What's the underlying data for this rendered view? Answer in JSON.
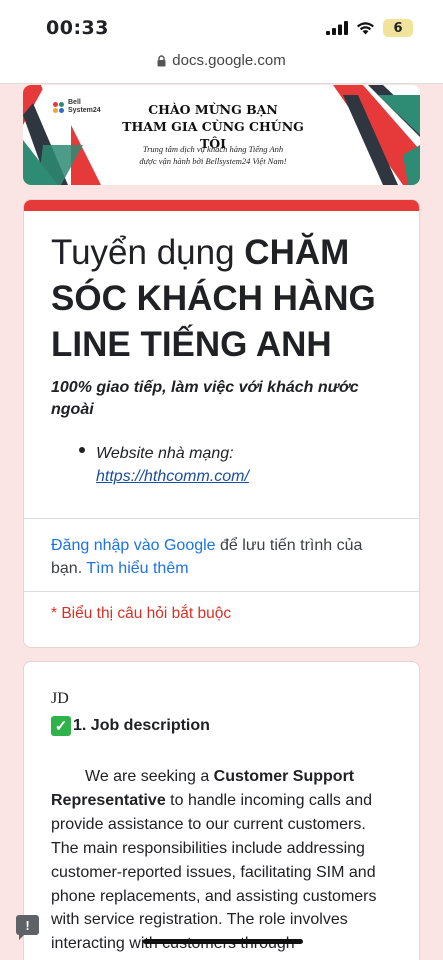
{
  "status_bar": {
    "time": "00:33",
    "battery": "6"
  },
  "browser": {
    "url": "docs.google.com"
  },
  "banner": {
    "logo_line1": "Bell",
    "logo_line2": "System24",
    "title_line1": "CHÀO MỪNG BẠN",
    "title_line2": "THAM GIA CÙNG CHÚNG TÔI",
    "sub_line1": "Trung tâm dịch vụ khách hàng Tiếng Anh",
    "sub_line2": "được vận hành bởi Bellsystem24 Việt Nam!"
  },
  "form": {
    "title_regular": "Tuyển dụng ",
    "title_bold": "CHĂM SÓC KHÁCH HÀNG LINE TIẾNG ANH",
    "description": "100% giao tiếp, làm việc với khách nước ngoài",
    "website_label": "Website nhà mạng:",
    "website_url": "https://hthcomm.com/",
    "signin_link": "Đăng nhập vào Google",
    "signin_text": " để lưu tiến trình của bạn. ",
    "learn_more": "Tìm hiểu thêm",
    "required_note": "* Biểu thị câu hỏi bắt buộc"
  },
  "section": {
    "label": "JD",
    "heading": "1. Job description",
    "body_prefix": "We are seeking a ",
    "body_bold": "Customer Support Representative",
    "body_rest": " to handle incoming calls and provide assistance to our current customers. The main responsibilities include addressing customer-reported issues, facilitating SIM and phone replacements, and assisting customers with service registration. The role involves interacting with customers through"
  },
  "colors": {
    "accent_red": "#e63a3a",
    "link_blue": "#1a73e8",
    "required_red": "#d93025",
    "page_bg": "#fbe5e4"
  }
}
